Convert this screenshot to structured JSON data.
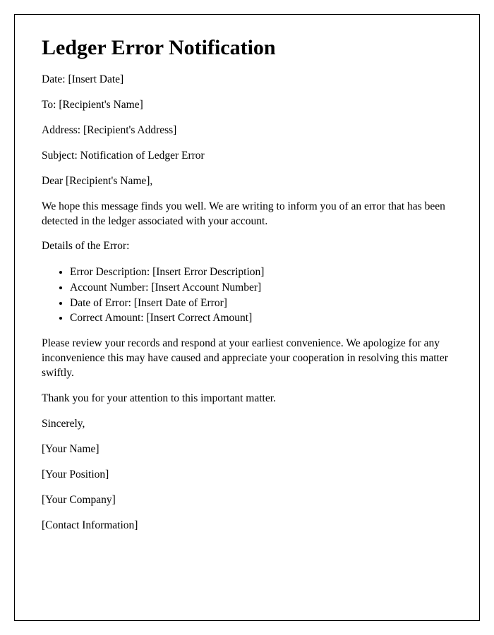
{
  "title": "Ledger Error Notification",
  "date_line": "Date: [Insert Date]",
  "to_line": "To: [Recipient's Name]",
  "address_line": "Address: [Recipient's Address]",
  "subject_line": "Subject: Notification of Ledger Error",
  "salutation": "Dear [Recipient's Name],",
  "intro_paragraph": "We hope this message finds you well. We are writing to inform you of an error that has been detected in the ledger associated with your account.",
  "details_header": "Details of the Error:",
  "error_details": {
    "item1": "Error Description: [Insert Error Description]",
    "item2": "Account Number: [Insert Account Number]",
    "item3": "Date of Error: [Insert Date of Error]",
    "item4": "Correct Amount: [Insert Correct Amount]"
  },
  "review_paragraph": "Please review your records and respond at your earliest convenience. We apologize for any inconvenience this may have caused and appreciate your cooperation in resolving this matter swiftly.",
  "thank_you": "Thank you for your attention to this important matter.",
  "closing": "Sincerely,",
  "sender_name": "[Your Name]",
  "sender_position": "[Your Position]",
  "sender_company": "[Your Company]",
  "contact_info": "[Contact Information]"
}
